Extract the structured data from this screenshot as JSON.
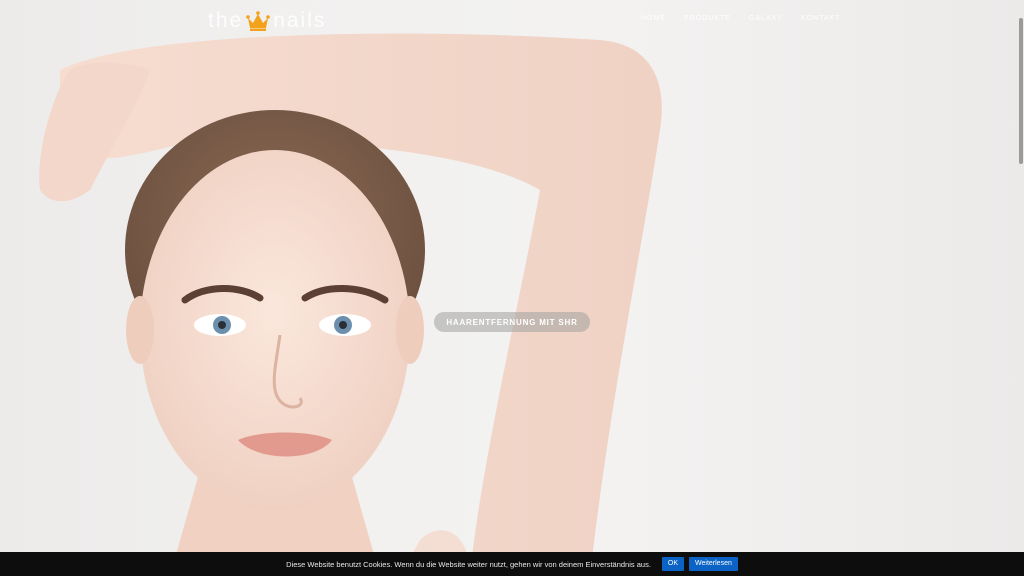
{
  "logo": {
    "word_left": "the",
    "word_right": "nails",
    "crown_icon": "crown-icon",
    "crown_color": "#f2a21b"
  },
  "nav": {
    "items": [
      {
        "label": "HOME"
      },
      {
        "label": "PRODUKTE"
      },
      {
        "label": "GALAXY"
      },
      {
        "label": "KONTAKT"
      }
    ]
  },
  "hero": {
    "cta_label": "HAARENTFERNUNG MIT SHR",
    "image": "woman-portrait-raised-arm"
  },
  "cookie": {
    "text": "Diese Website benutzt Cookies. Wenn du die Website weiter nutzt, gehen wir von deinem Einverständnis aus.",
    "ok_label": "OK",
    "more_label": "Weiterlesen",
    "button_color": "#0b64c5"
  }
}
